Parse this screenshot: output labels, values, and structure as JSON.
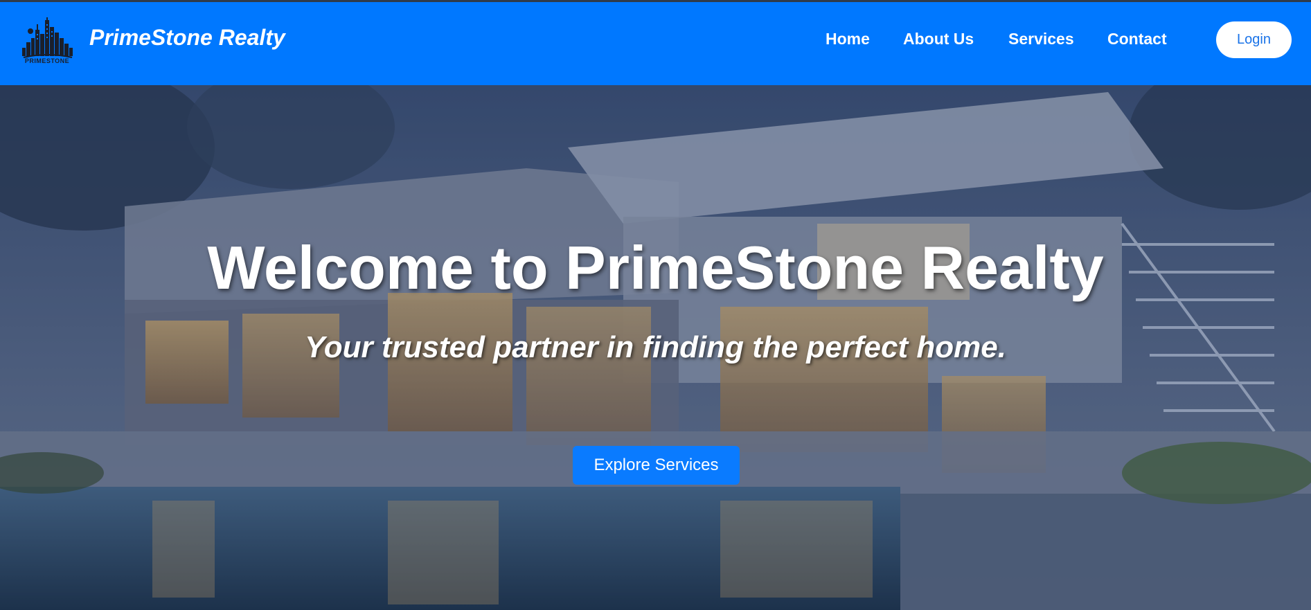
{
  "brand": {
    "logo_text": "PRIMESTONE",
    "name": "PrimeStone Realty"
  },
  "nav": {
    "items": [
      {
        "label": "Home"
      },
      {
        "label": "About Us"
      },
      {
        "label": "Services"
      },
      {
        "label": "Contact"
      }
    ],
    "login_label": "Login"
  },
  "hero": {
    "title": "Welcome to PrimeStone Realty",
    "subtitle": "Your trusted partner in finding the perfect home.",
    "cta_label": "Explore Services",
    "background": "modern-house-with-pool-photo"
  },
  "colors": {
    "navbar": "#0078ff",
    "button": "#0a7bff",
    "text": "#ffffff"
  }
}
